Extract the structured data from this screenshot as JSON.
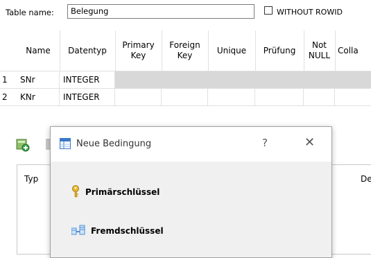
{
  "table_name": {
    "label": "Table name:",
    "value": "Belegung"
  },
  "without_rowid": {
    "label": "WITHOUT ROWID",
    "checked": false
  },
  "grid": {
    "headers": [
      "",
      "Name",
      "Datentyp",
      "Primary\nKey",
      "Foreign\nKey",
      "Unique",
      "Prüfung",
      "Not\nNULL",
      "Colla"
    ],
    "rows": [
      {
        "num": "1",
        "name": "SNr",
        "type": "INTEGER"
      },
      {
        "num": "2",
        "name": "KNr",
        "type": "INTEGER"
      }
    ]
  },
  "lower_panel": {
    "col_typ": "Typ",
    "col_de": "De"
  },
  "dialog": {
    "title": "Neue Bedingung",
    "help": "?",
    "close": "✕",
    "options": [
      {
        "label": "Primärschlüssel",
        "icon": "key-icon"
      },
      {
        "label": "Fremdschlüssel",
        "icon": "foreign-key-icon"
      }
    ]
  },
  "colors": {
    "shaded_cell": "#d8d8d8",
    "key_gold": "#d9a520",
    "fk_blue": "#4a90d9"
  }
}
